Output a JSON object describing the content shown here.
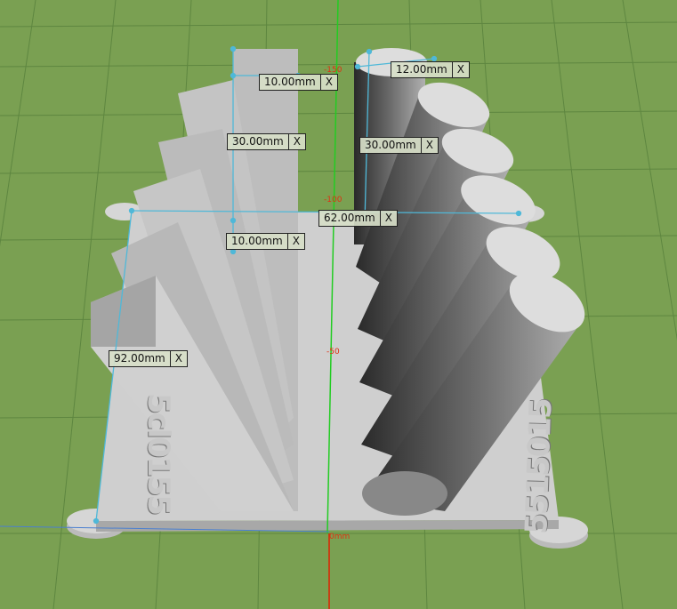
{
  "viewport": {
    "axis_labels": [
      "-150",
      "-100",
      "-50",
      "0mm"
    ],
    "plate_text_left": "5cl0155",
    "plate_text_right": "5515015"
  },
  "measurements": [
    {
      "value": "10.00mm",
      "close": "X"
    },
    {
      "value": "12.00mm",
      "close": "X"
    },
    {
      "value": "30.00mm",
      "close": "X"
    },
    {
      "value": "30.00mm",
      "close": "X"
    },
    {
      "value": "62.00mm",
      "close": "X"
    },
    {
      "value": "10.00mm",
      "close": "X"
    },
    {
      "value": "92.00mm",
      "close": "X"
    }
  ],
  "colors": {
    "grid_bg": "#7aa052",
    "grid_line": "#5e8640",
    "plate": "#cfcfcf",
    "y_axis": "#22cc22",
    "x_axis": "#e02000",
    "measure_line": "#4fb8d8"
  }
}
